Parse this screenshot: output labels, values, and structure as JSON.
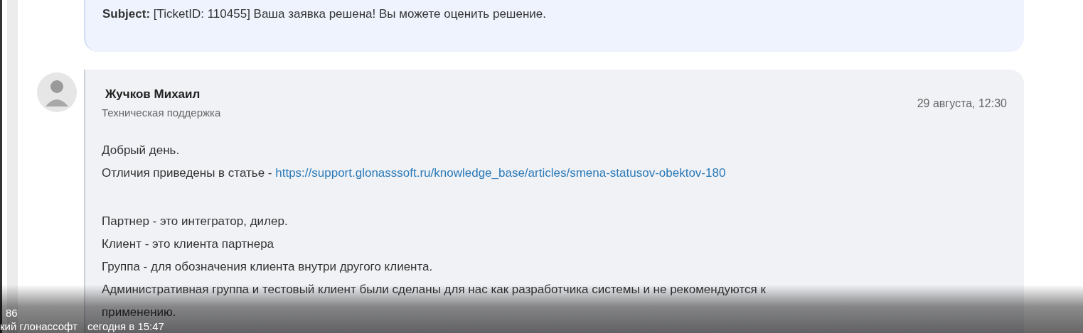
{
  "messages": [
    {
      "kind": "system",
      "subject_label": "Subject:",
      "subject": "[TicketID: 110455] Ваша заявка решена! Вы можете оценить решение."
    },
    {
      "kind": "reply",
      "author": "Жучков Михаил",
      "role": "Техническая поддержка",
      "date": "29 августа, 12:30",
      "lines": [
        {
          "text": "Добрый день."
        },
        {
          "text": "Отличия приведены в статье - ",
          "link": "https://support.glonasssoft.ru/knowledge_base/articles/smena-statusov-obektov-180"
        },
        {
          "kind": "blank"
        },
        {
          "text": "Партнер - это интегратор, дилер."
        },
        {
          "text": "Клиент - это клиента партнера"
        },
        {
          "text": "Группа - для обозначения клиента внутри другого клиента."
        },
        {
          "text": "Административная группа и тестовый клиент были сделаны для нас как разработчика системы и не рекомендуются к"
        },
        {
          "text": "применению."
        }
      ]
    }
  ],
  "video_overlay": {
    "line_1": "86",
    "line_2_left": "кий глонассофт",
    "line_2_right": "сегодня в 15:47"
  }
}
